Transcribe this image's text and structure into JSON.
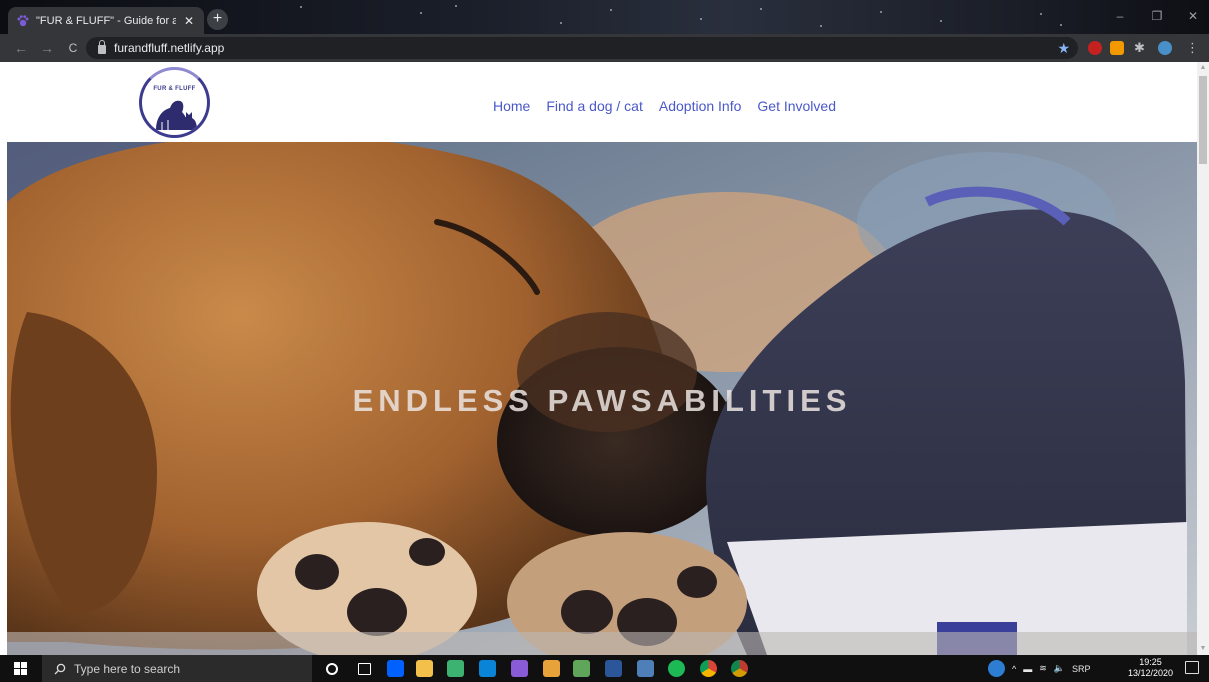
{
  "browser": {
    "tab_title": "\"FUR & FLUFF\" - Guide for adopti",
    "tab_close": "✕",
    "new_tab": "+",
    "url": "furandfluff.netlify.app",
    "back": "←",
    "forward": "→",
    "reload": "C",
    "window_min": "–",
    "window_restore": "❐",
    "window_close": "✕"
  },
  "site": {
    "logo_text": "FUR & FLUFF",
    "nav": [
      "Home",
      "Find a dog / cat",
      "Adoption Info",
      "Get Involved"
    ],
    "hero_text": "ENDLESS PAWSABILITIES"
  },
  "taskbar": {
    "search_placeholder": "Type here to search",
    "language": "SRP",
    "time": "19:25",
    "date": "13/12/2020"
  },
  "colors": {
    "nav_link": "#4a58c8",
    "logo_ring": "#3c3b8e",
    "chrome_tab": "#35363a",
    "omnibox": "#202124"
  }
}
